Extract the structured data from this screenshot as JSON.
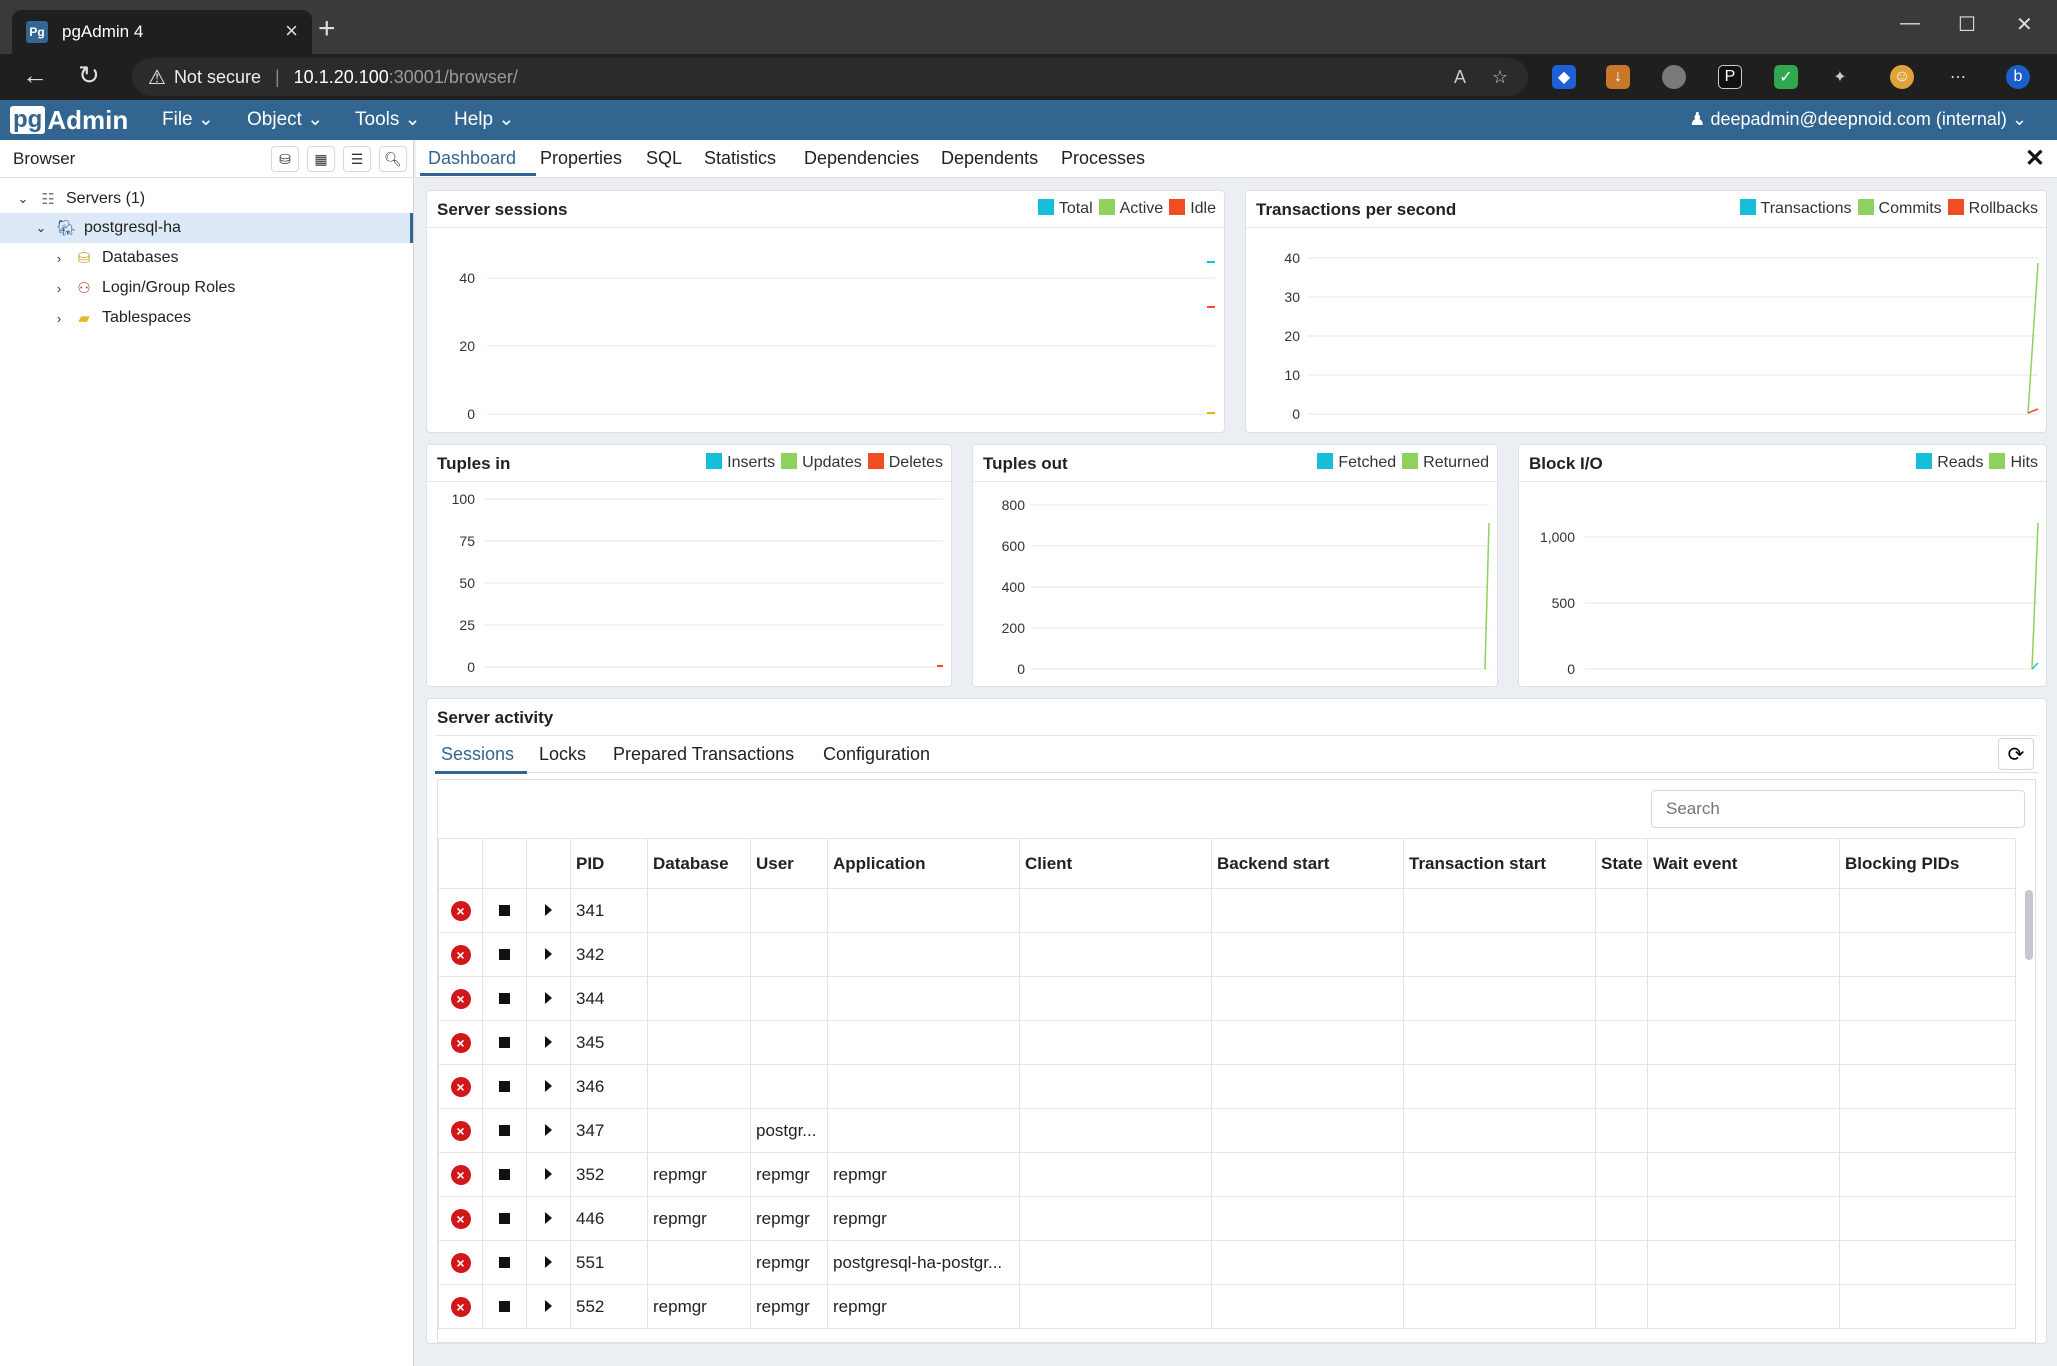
{
  "browser": {
    "tab_title": "pgAdmin 4",
    "favicon": "Pg",
    "security": "Not secure",
    "url_host": "10.1.20.100",
    "url_path": ":30001/browser/",
    "colors": {
      "chrome": "#1f1f1f",
      "tabbar": "#3a3a3a"
    }
  },
  "app": {
    "logo_pg": "pg",
    "logo_admin": "Admin",
    "menus": [
      "File",
      "Object",
      "Tools",
      "Help"
    ],
    "user": "deepadmin@deepnoid.com (internal)",
    "accent": "#326690"
  },
  "left_panel": {
    "title": "Browser",
    "tree": [
      {
        "label": "Servers (1)",
        "icon": "servers-icon"
      },
      {
        "label": "postgresql-ha",
        "icon": "postgres-elephant-icon"
      },
      {
        "label": "Databases",
        "icon": "databases-icon"
      },
      {
        "label": "Login/Group Roles",
        "icon": "roles-icon"
      },
      {
        "label": "Tablespaces",
        "icon": "tablespaces-icon"
      }
    ]
  },
  "main_tabs": [
    "Dashboard",
    "Properties",
    "SQL",
    "Statistics",
    "Dependencies",
    "Dependents",
    "Processes"
  ],
  "charts": {
    "sessions": {
      "title": "Server sessions",
      "legend": [
        "Total",
        "Active",
        "Idle"
      ],
      "ticks": [
        "40",
        "20",
        "0"
      ]
    },
    "tps": {
      "title": "Transactions per second",
      "legend": [
        "Transactions",
        "Commits",
        "Rollbacks"
      ],
      "ticks": [
        "40",
        "30",
        "20",
        "10",
        "0"
      ]
    },
    "tuples_in": {
      "title": "Tuples in",
      "legend": [
        "Inserts",
        "Updates",
        "Deletes"
      ],
      "ticks": [
        "100",
        "75",
        "50",
        "25",
        "0"
      ]
    },
    "tuples_out": {
      "title": "Tuples out",
      "legend": [
        "Fetched",
        "Returned"
      ],
      "ticks": [
        "800",
        "600",
        "400",
        "200",
        "0"
      ]
    },
    "block_io": {
      "title": "Block I/O",
      "legend": [
        "Reads",
        "Hits"
      ],
      "ticks": [
        "1,000",
        "500",
        "0"
      ]
    },
    "series_colors": {
      "c1": "#17bed8",
      "c2": "#8fd15f",
      "c3": "#f04d22"
    }
  },
  "activity": {
    "title": "Server activity",
    "tabs": [
      "Sessions",
      "Locks",
      "Prepared Transactions",
      "Configuration"
    ],
    "search_placeholder": "Search",
    "columns": [
      "PID",
      "Database",
      "User",
      "Application",
      "Client",
      "Backend start",
      "Transaction start",
      "State",
      "Wait event",
      "Blocking PIDs"
    ],
    "rows": [
      [
        "341",
        "",
        "",
        "",
        "",
        "",
        "",
        "",
        "",
        ""
      ],
      [
        "342",
        "",
        "",
        "",
        "",
        "",
        "",
        "",
        "",
        ""
      ],
      [
        "344",
        "",
        "",
        "",
        "",
        "",
        "",
        "",
        "",
        ""
      ],
      [
        "345",
        "",
        "",
        "",
        "",
        "",
        "",
        "",
        "",
        ""
      ],
      [
        "346",
        "",
        "",
        "",
        "",
        "",
        "",
        "",
        "",
        ""
      ],
      [
        "347",
        "",
        "postgr...",
        "",
        "",
        "",
        "",
        "",
        "",
        ""
      ],
      [
        "352",
        "repmgr",
        "repmgr",
        "repmgr",
        "",
        "",
        "",
        "",
        "",
        ""
      ],
      [
        "446",
        "repmgr",
        "repmgr",
        "repmgr",
        "",
        "",
        "",
        "",
        "",
        ""
      ],
      [
        "551",
        "",
        "repmgr",
        "postgresql-ha-postgr...",
        "",
        "",
        "",
        "",
        "",
        ""
      ],
      [
        "552",
        "repmgr",
        "repmgr",
        "repmgr",
        "",
        "",
        "",
        "",
        "",
        ""
      ]
    ]
  }
}
